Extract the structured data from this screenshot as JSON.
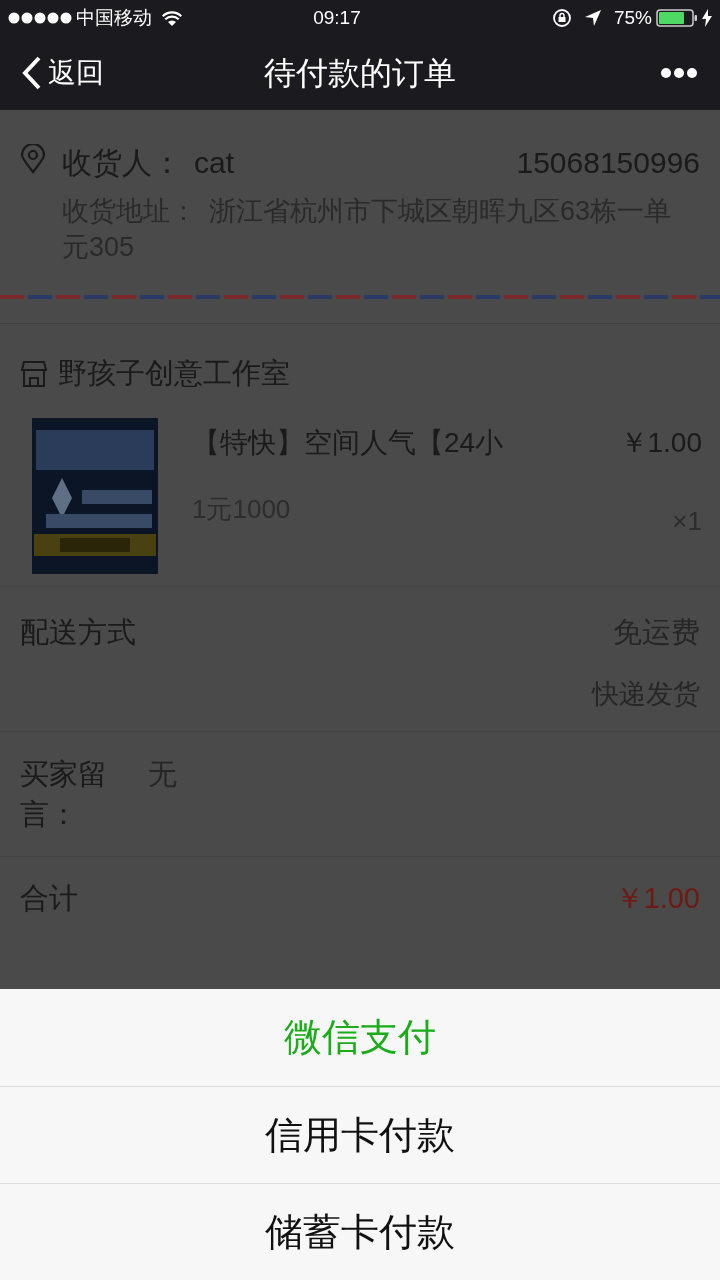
{
  "status_bar": {
    "carrier": "中国移动",
    "time": "09:17",
    "battery": "75%"
  },
  "nav": {
    "back": "返回",
    "title": "待付款的订单"
  },
  "address": {
    "name_label": "收货人：",
    "name": "cat",
    "phone": "15068150996",
    "address_label": "收货地址：",
    "address": "浙江省杭州市下城区朝晖九区63栋一单元305"
  },
  "shop": {
    "name": "野孩子创意工作室"
  },
  "item": {
    "title": "【特快】空间人气【24小",
    "spec": "1元1000",
    "price": "￥1.00",
    "quantity": "×1"
  },
  "shipping": {
    "label": "配送方式",
    "fee": "免运费",
    "method": "快递发货"
  },
  "note": {
    "label": "买家留言：",
    "value": "无"
  },
  "total": {
    "label": "合计",
    "amount": "￥1.00"
  },
  "action_sheet": {
    "options": [
      {
        "label": "微信支付",
        "kind": "primary"
      },
      {
        "label": "信用卡付款",
        "kind": "normal"
      },
      {
        "label": "储蓄卡付款",
        "kind": "normal"
      }
    ]
  }
}
